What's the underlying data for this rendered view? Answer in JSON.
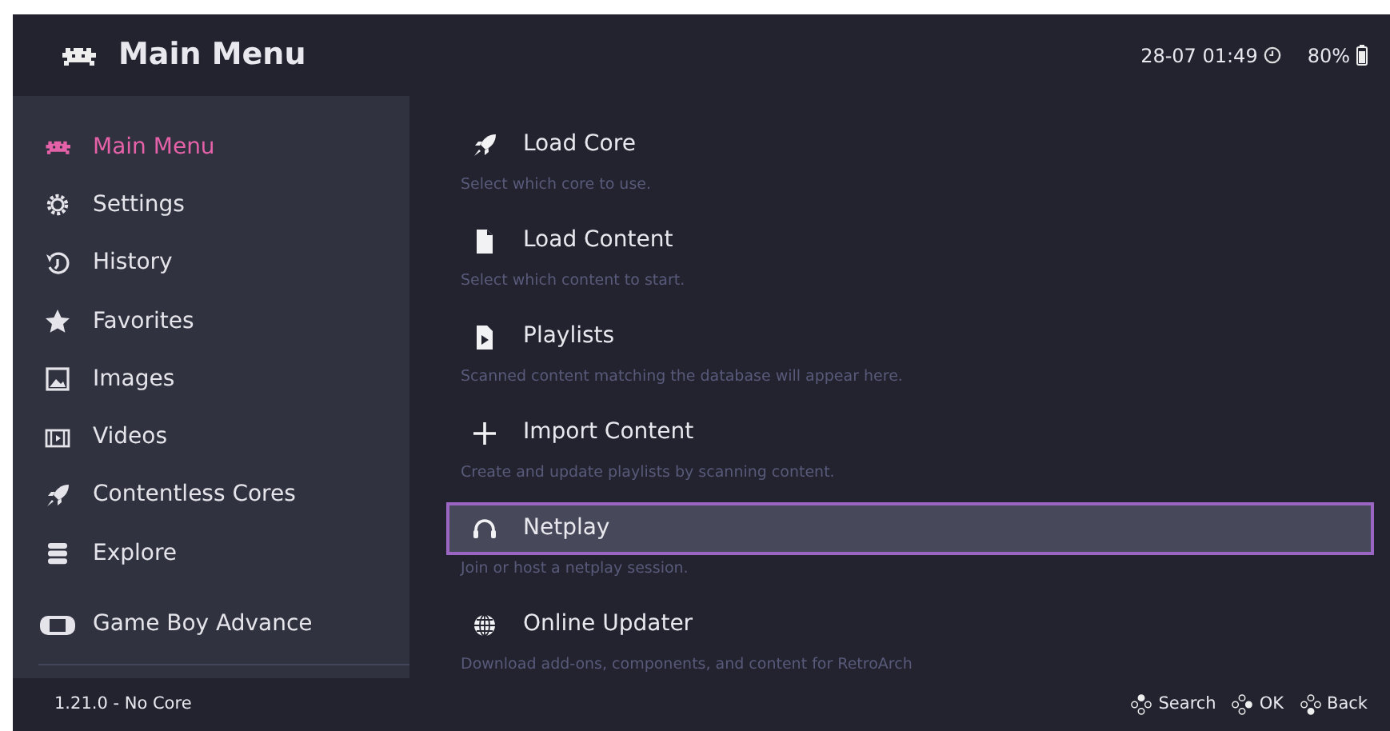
{
  "header": {
    "title": "Main Menu",
    "clock": "28-07 01:49",
    "battery": "80%"
  },
  "sidebar": {
    "items": [
      {
        "label": "Main Menu",
        "kind": "invader",
        "selected": true
      },
      {
        "label": "Settings",
        "kind": "gear",
        "selected": false
      },
      {
        "label": "History",
        "kind": "history",
        "selected": false
      },
      {
        "label": "Favorites",
        "kind": "star",
        "selected": false
      },
      {
        "label": "Images",
        "kind": "image",
        "selected": false
      },
      {
        "label": "Videos",
        "kind": "film",
        "selected": false
      },
      {
        "label": "Contentless Cores",
        "kind": "rocket",
        "selected": false
      },
      {
        "label": "Explore",
        "kind": "database",
        "selected": false
      },
      {
        "label": "Game Boy Advance",
        "kind": "handheld",
        "selected": false
      }
    ]
  },
  "menu": {
    "items": [
      {
        "label": "Load Core",
        "kind": "rocket",
        "description": "Select which core to use.",
        "selected": false
      },
      {
        "label": "Load Content",
        "kind": "file",
        "description": "Select which content to start.",
        "selected": false
      },
      {
        "label": "Playlists",
        "kind": "playfile",
        "description": "Scanned content matching the database will appear here.",
        "selected": false
      },
      {
        "label": "Import Content",
        "kind": "plus",
        "description": "Create and update playlists by scanning content.",
        "selected": false
      },
      {
        "label": "Netplay",
        "kind": "headset",
        "description": "Join or host a netplay session.",
        "selected": true
      },
      {
        "label": "Online Updater",
        "kind": "globe",
        "description": "Download add-ons, components, and content for RetroArch",
        "selected": false
      }
    ]
  },
  "status_bar": {
    "version": "1.21.0 - No Core",
    "hints": [
      "Search",
      "OK",
      "Back"
    ]
  }
}
